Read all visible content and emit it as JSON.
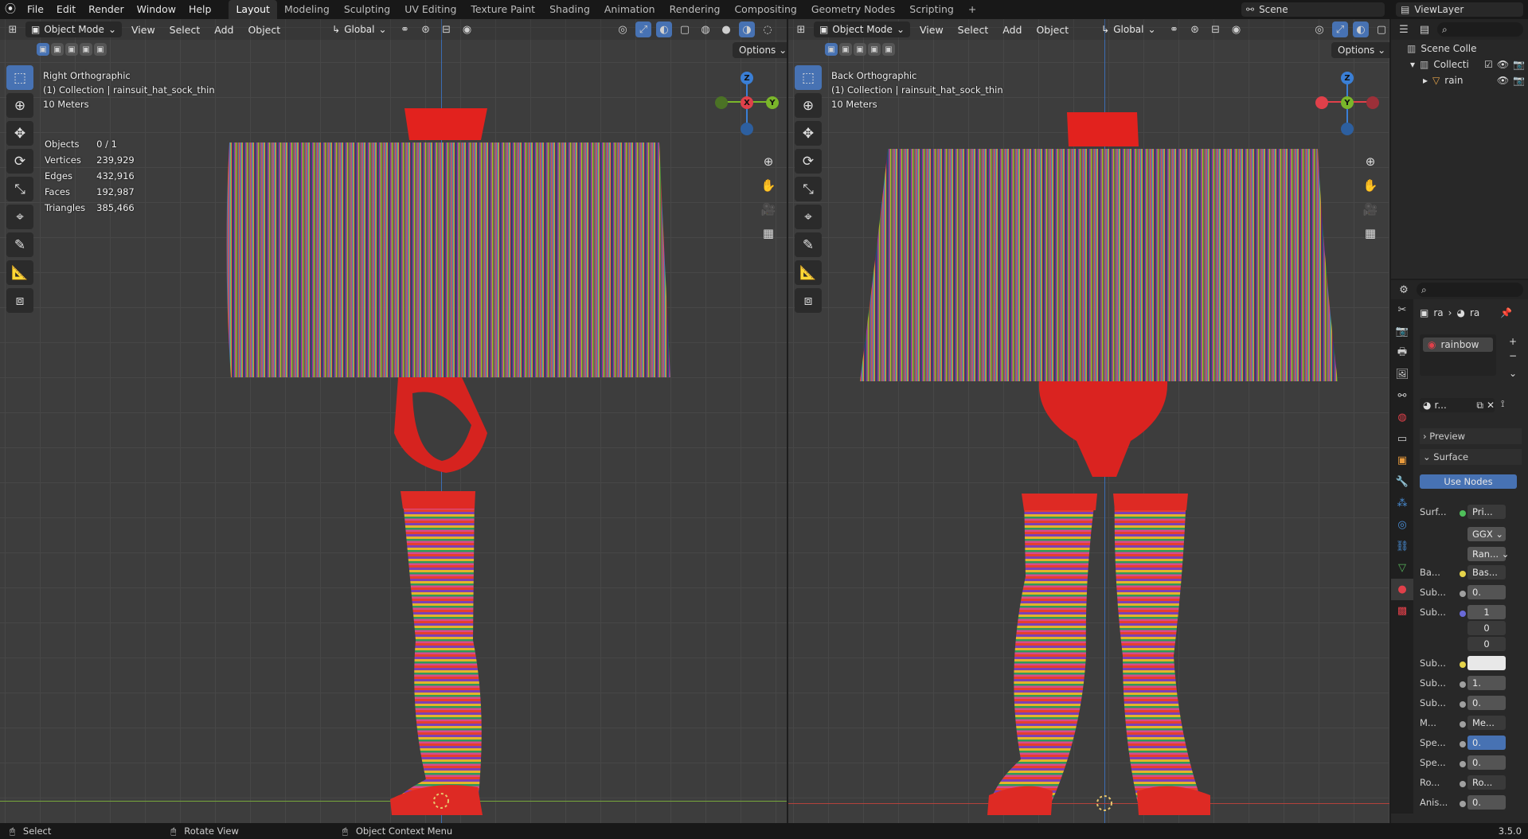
{
  "topbar": {
    "menus": [
      "File",
      "Edit",
      "Render",
      "Window",
      "Help"
    ],
    "workspaces": [
      "Layout",
      "Modeling",
      "Sculpting",
      "UV Editing",
      "Texture Paint",
      "Shading",
      "Animation",
      "Rendering",
      "Compositing",
      "Geometry Nodes",
      "Scripting"
    ],
    "active_workspace": "Layout",
    "add_workspace": "+",
    "scene": "Scene",
    "view_layer": "ViewLayer"
  },
  "viewport_left": {
    "mode": "Object Mode",
    "menus": [
      "View",
      "Select",
      "Add",
      "Object"
    ],
    "transform": "Global",
    "options": "Options",
    "view_name": "Right Orthographic",
    "collection": "(1) Collection | rainsuit_hat_sock_thin",
    "scale": "10 Meters",
    "stats": [
      {
        "label": "Objects",
        "value": "0 / 1"
      },
      {
        "label": "Vertices",
        "value": "239,929"
      },
      {
        "label": "Edges",
        "value": "432,916"
      },
      {
        "label": "Faces",
        "value": "192,987"
      },
      {
        "label": "Triangles",
        "value": "385,466"
      }
    ],
    "gizmo": {
      "top": "Z",
      "center": "X",
      "right": "Y"
    }
  },
  "viewport_right": {
    "mode": "Object Mode",
    "menus": [
      "View",
      "Select",
      "Add",
      "Object"
    ],
    "transform": "Global",
    "options": "Options",
    "view_name": "Back Orthographic",
    "collection": "(1) Collection | rainsuit_hat_sock_thin",
    "scale": "10 Meters",
    "gizmo": {
      "top": "Z",
      "center": "Y"
    }
  },
  "outliner": {
    "items": [
      {
        "label": "Scene Colle"
      },
      {
        "label": "Collecti"
      },
      {
        "label": "rain"
      }
    ]
  },
  "properties": {
    "breadcrumb": [
      "ra",
      "ra"
    ],
    "material": "rainbow",
    "material_field": "r...",
    "preview": "Preview",
    "surface": "Surface",
    "use_nodes": "Use Nodes",
    "rows": [
      {
        "label": "Surf...",
        "value": "Pri..."
      },
      {
        "label": "",
        "value": "GGX"
      },
      {
        "label": "",
        "value": "Ran..."
      },
      {
        "label": "Ba...",
        "value": "Bas..."
      },
      {
        "label": "Sub...",
        "value": "0."
      },
      {
        "label": "Sub...",
        "value": "1"
      },
      {
        "label": "",
        "value": "0"
      },
      {
        "label": "",
        "value": "0"
      },
      {
        "label": "Sub...",
        "value": ""
      },
      {
        "label": "Sub...",
        "value": "1."
      },
      {
        "label": "Sub...",
        "value": "0."
      },
      {
        "label": "M...",
        "value": "Me..."
      },
      {
        "label": "Spe...",
        "value": "0."
      },
      {
        "label": "Spe...",
        "value": "0."
      },
      {
        "label": "Ro...",
        "value": "Ro..."
      },
      {
        "label": "Anis...",
        "value": "0."
      }
    ]
  },
  "statusbar": {
    "select": "Select",
    "rotate": "Rotate View",
    "context": "Object Context Menu",
    "version": "3.5.0"
  },
  "colors": {
    "accent": "#4772b3",
    "axis_x": "#e0404a",
    "axis_y": "#7ab62a",
    "axis_z": "#3a7fd6"
  }
}
